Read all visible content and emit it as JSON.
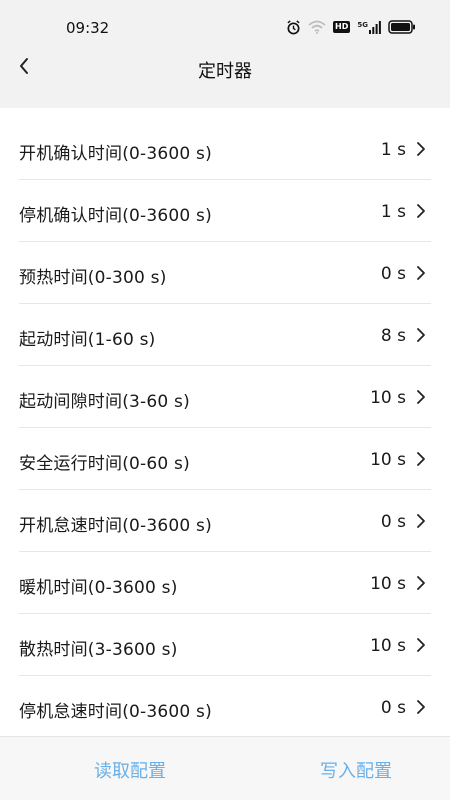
{
  "status_bar": {
    "time": "09:32",
    "icons": [
      "alarm-icon",
      "wifi-icon",
      "hd-icon",
      "signal-5g-icon",
      "battery-icon"
    ],
    "hd_label": "HD",
    "network_label": "5G"
  },
  "header": {
    "title": "定时器",
    "back_icon": "chevron-left-icon"
  },
  "settings": [
    {
      "label": "开机确认时间(0-3600 s)",
      "value": "1 s"
    },
    {
      "label": "停机确认时间(0-3600 s)",
      "value": "1 s"
    },
    {
      "label": "预热时间(0-300 s)",
      "value": "0 s"
    },
    {
      "label": "起动时间(1-60 s)",
      "value": "8 s"
    },
    {
      "label": "起动间隙时间(3-60 s)",
      "value": "10 s"
    },
    {
      "label": "安全运行时间(0-60 s)",
      "value": "10 s"
    },
    {
      "label": "开机怠速时间(0-3600 s)",
      "value": "0 s"
    },
    {
      "label": "暖机时间(0-3600 s)",
      "value": "10 s"
    },
    {
      "label": "散热时间(3-3600 s)",
      "value": "10 s"
    },
    {
      "label": "停机怠速时间(0-3600 s)",
      "value": "0 s"
    }
  ],
  "footer": {
    "read_label": "读取配置",
    "write_label": "写入配置",
    "accent_color": "#6ab0e8"
  }
}
